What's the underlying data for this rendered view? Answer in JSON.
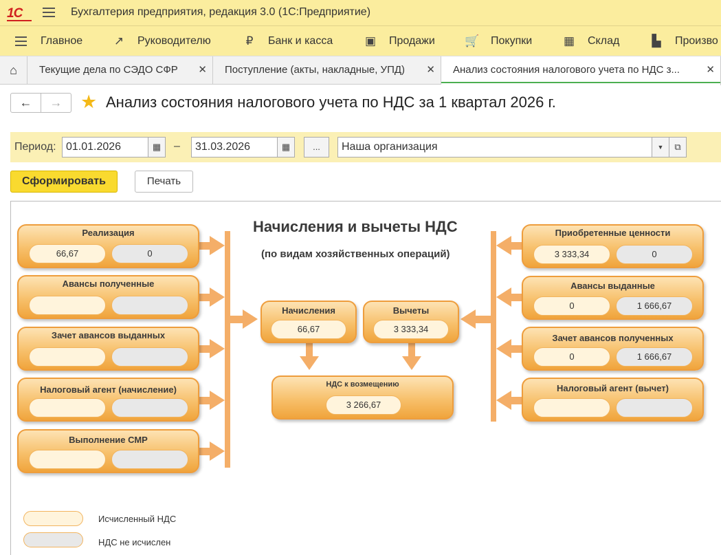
{
  "app": {
    "title": "Бухгалтерия предприятия, редакция 3.0  (1С:Предприятие)",
    "logo": "1С"
  },
  "sections": [
    {
      "label": "Главное",
      "icon": "menu-icon"
    },
    {
      "label": "Руководителю",
      "icon": "trend-icon"
    },
    {
      "label": "Банк и касса",
      "icon": "ruble-coin-icon"
    },
    {
      "label": "Продажи",
      "icon": "shopping-bag-icon"
    },
    {
      "label": "Покупки",
      "icon": "cart-icon"
    },
    {
      "label": "Склад",
      "icon": "warehouse-icon"
    },
    {
      "label": "Произво",
      "icon": "factory-icon"
    }
  ],
  "tabs": [
    {
      "label": "Текущие дела по СЭДО СФР"
    },
    {
      "label": "Поступление (акты, накладные, УПД)"
    },
    {
      "label": "Анализ состояния налогового учета по НДС з...",
      "active": true
    }
  ],
  "form": {
    "title": "Анализ состояния налогового учета по НДС за 1 квартал 2026 г."
  },
  "filter": {
    "period_label": "Период:",
    "date_from": "01.01.2026",
    "dash": "–",
    "date_to": "31.03.2026",
    "more": "...",
    "organization": "Наша организация"
  },
  "buttons": {
    "generate": "Сформировать",
    "print": "Печать"
  },
  "diagram": {
    "title": "Начисления и вычеты НДС",
    "subtitle": "(по видам хозяйственных операций)",
    "left": [
      {
        "label": "Реализация",
        "v1": "66,67",
        "v2": "0"
      },
      {
        "label": "Авансы полученные",
        "v1": "",
        "v2": ""
      },
      {
        "label": "Зачет авансов выданных",
        "v1": "",
        "v2": ""
      },
      {
        "label": "Налоговый агент (начисление)",
        "v1": "",
        "v2": ""
      },
      {
        "label": "Выполнение СМР",
        "v1": "",
        "v2": ""
      }
    ],
    "right": [
      {
        "label": "Приобретенные ценности",
        "v1": "3 333,34",
        "v2": "0"
      },
      {
        "label": "Авансы выданные",
        "v1": "0",
        "v2": "1 666,67"
      },
      {
        "label": "Зачет авансов полученных",
        "v1": "0",
        "v2": "1 666,67"
      },
      {
        "label": "Налоговый агент (вычет)",
        "v1": "",
        "v2": ""
      }
    ],
    "accruals": {
      "label": "Начисления",
      "value": "66,67"
    },
    "deductions": {
      "label": "Вычеты",
      "value": "3 333,34"
    },
    "refund": {
      "label": "НДС к возмещению",
      "value": "3 266,67"
    },
    "legend": {
      "calculated": "Исчисленный НДС",
      "not_calculated": "НДС не исчислен"
    },
    "colors": {
      "box": "#f7c06b",
      "border": "#ee9d3c",
      "arrow": "#f4ae68",
      "calculated": "#fff4dc",
      "not_calculated": "#e8e8e8"
    }
  }
}
